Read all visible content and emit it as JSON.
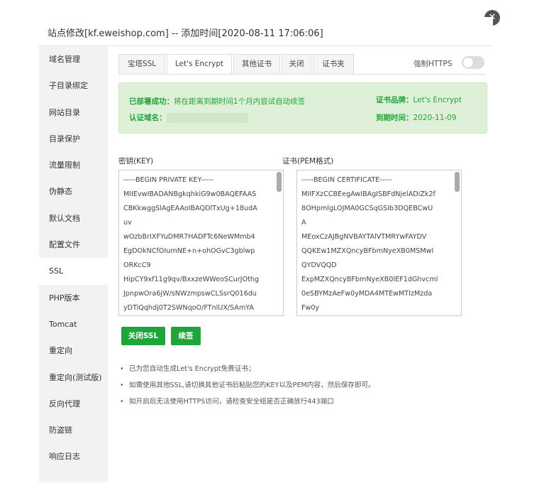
{
  "dialog": {
    "title": "站点修改[kf.eweishop.com] -- 添加时间[2020-08-11 17:06:06]",
    "close_icon": "close-icon"
  },
  "sidebar": {
    "items": [
      {
        "label": "域名管理"
      },
      {
        "label": "子目录绑定"
      },
      {
        "label": "网站目录"
      },
      {
        "label": "目录保护"
      },
      {
        "label": "流量限制"
      },
      {
        "label": "伪静态"
      },
      {
        "label": "默认文档"
      },
      {
        "label": "配置文件"
      },
      {
        "label": "SSL",
        "active": true
      },
      {
        "label": "PHP版本"
      },
      {
        "label": "Tomcat"
      },
      {
        "label": "重定向"
      },
      {
        "label": "重定向(测试版)"
      },
      {
        "label": "反向代理"
      },
      {
        "label": "防盗链"
      },
      {
        "label": "响应日志"
      }
    ]
  },
  "tabs": [
    {
      "label": "宝塔SSL"
    },
    {
      "label": "Let's Encrypt",
      "active": true
    },
    {
      "label": "其他证书"
    },
    {
      "label": "关闭"
    },
    {
      "label": "证书夹"
    }
  ],
  "force_https": {
    "label": "强制HTTPS",
    "enabled": false
  },
  "info": {
    "deployed_key": "已部署成功：",
    "deployed_value": "将在距离到期时间1个月内尝试自动续签",
    "domain_key": "认证域名：",
    "brand_key": "证书品牌：",
    "brand_value": "Let's Encrypt",
    "expire_key": "到期时间：",
    "expire_value": "2020-11-09"
  },
  "key_field": {
    "label": "密钥(KEY)",
    "value": "-----BEGIN PRIVATE KEY-----\nMIIEvwIBADANBgkqhkiG9w0BAQEFAAS\nCBKkwggSlAgEAAoIBAQDlTxUg+18udA\nuv\nwOzbBrIXFYuDMR7HADFTc6NeWMmb4\nEgDOkNCfOIumNE+n+ohOGvC3gblwp\nORKcC9\nHipCY9xf11g9qv/BxxzeWWeoSCurJOthg\nJpnpwOra6jW/sNWzmpswCLSsrQ016du\nyDTiQqhdj0T2SWNqoO/FTnlUX/SAmYA"
  },
  "cert_field": {
    "label": "证书(PEM格式)",
    "value": "-----BEGIN CERTIFICATE-----\nMIIFXzCCBEegAwIBAgISBFdNjelADiZk2f\n8OHpmlgLOJMA0GCSqGSIb3DQEBCwU\nA\nMEoxCzAJBgNVBAYTAlVTMRYwFAYDV\nQQKEw1MZXQncyBFbmNyeXB0MSMwI\nQYDVQQD\nExpMZXQncyBFbmNyeXB0IEF1dGhvcml\n0eSBYMzAeFw0yMDA4MTEwMTIzMzda\nFw0y"
  },
  "buttons": {
    "close_ssl": "关闭SSL",
    "renew": "续签"
  },
  "tips": [
    "已为您自动生成Let's Encrypt免费证书；",
    "如需使用其他SSL,请切换其他证书后粘贴您的KEY以及PEM内容，然后保存即可。",
    "如开启后无法使用HTTPS访问，请检查安全组是否正确放行443端口"
  ],
  "colors": {
    "accent": "#20a53a",
    "info_bg": "#dff0d8"
  }
}
